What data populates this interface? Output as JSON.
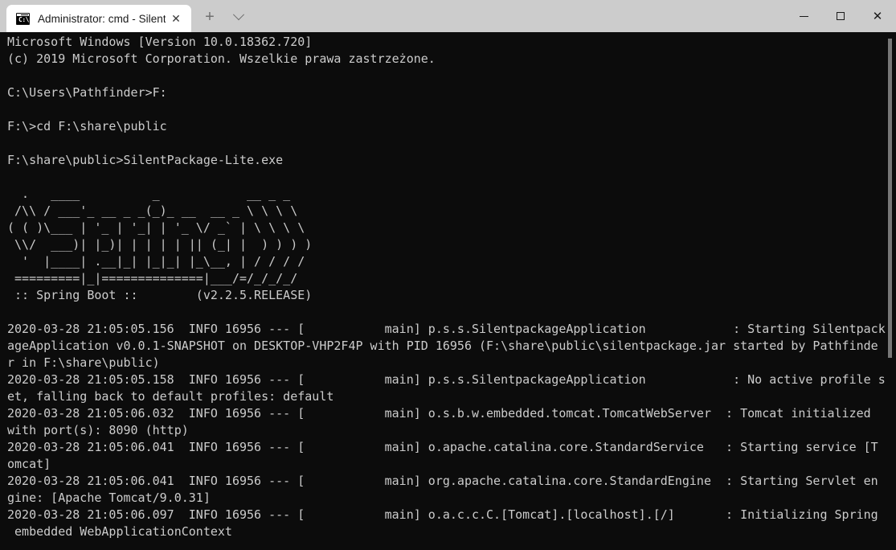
{
  "window": {
    "tab": {
      "title": "Administrator: cmd - SilentPack",
      "icon": "cmd-console-icon",
      "icon_text": "C:\\",
      "close_label": "✕"
    },
    "new_tab_label": "+",
    "dropdown_label": "⌄",
    "controls": {
      "minimize_label": "—",
      "maximize_label": "□",
      "close_label": "✕"
    },
    "colors": {
      "titlebar_bg": "#cccccc",
      "tab_bg": "#ffffff",
      "terminal_bg": "#0c0c0c",
      "terminal_fg": "#cccccc",
      "scrollbar_thumb": "#777777"
    }
  },
  "terminal": {
    "lines": [
      "Microsoft Windows [Version 10.0.18362.720]",
      "(c) 2019 Microsoft Corporation. Wszelkie prawa zastrzeżone.",
      "",
      "C:\\Users\\Pathfinder>F:",
      "",
      "F:\\>cd F:\\share\\public",
      "",
      "F:\\share\\public>SilentPackage-Lite.exe",
      "",
      "  .   ____          _            __ _ _",
      " /\\\\ / ___'_ __ _ _(_)_ __  __ _ \\ \\ \\ \\",
      "( ( )\\___ | '_ | '_| | '_ \\/ _` | \\ \\ \\ \\",
      " \\\\/  ___)| |_)| | | | | || (_| |  ) ) ) )",
      "  '  |____| .__|_| |_|_| |_\\__, | / / / /",
      " =========|_|==============|___/=/_/_/_/",
      " :: Spring Boot ::        (v2.2.5.RELEASE)",
      "",
      "2020-03-28 21:05:05.156  INFO 16956 --- [           main] p.s.s.SilentpackageApplication            : Starting Silentpack",
      "ageApplication v0.0.1-SNAPSHOT on DESKTOP-VHP2F4P with PID 16956 (F:\\share\\public\\silentpackage.jar started by Pathfinde",
      "r in F:\\share\\public)",
      "2020-03-28 21:05:05.158  INFO 16956 --- [           main] p.s.s.SilentpackageApplication            : No active profile s",
      "et, falling back to default profiles: default",
      "2020-03-28 21:05:06.032  INFO 16956 --- [           main] o.s.b.w.embedded.tomcat.TomcatWebServer  : Tomcat initialized",
      "with port(s): 8090 (http)",
      "2020-03-28 21:05:06.041  INFO 16956 --- [           main] o.apache.catalina.core.StandardService   : Starting service [T",
      "omcat]",
      "2020-03-28 21:05:06.041  INFO 16956 --- [           main] org.apache.catalina.core.StandardEngine  : Starting Servlet en",
      "gine: [Apache Tomcat/9.0.31]",
      "2020-03-28 21:05:06.097  INFO 16956 --- [           main] o.a.c.c.C.[Tomcat].[localhost].[/]       : Initializing Spring",
      " embedded WebApplicationContext"
    ]
  }
}
